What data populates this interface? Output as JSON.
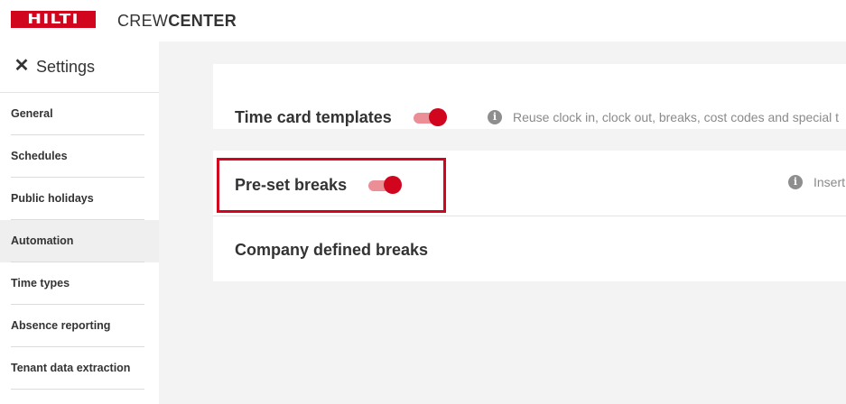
{
  "header": {
    "logo_text": "HILTI",
    "product_name_part1": "CREW",
    "product_name_part2": "CENTER",
    "brand_color": "#d2051e"
  },
  "sidebar": {
    "title": "Settings",
    "close_icon": "close-icon",
    "items": [
      {
        "label": "General",
        "active": false
      },
      {
        "label": "Schedules",
        "active": false
      },
      {
        "label": "Public holidays",
        "active": false
      },
      {
        "label": "Automation",
        "active": true
      },
      {
        "label": "Time types",
        "active": false
      },
      {
        "label": "Absence reporting",
        "active": false
      },
      {
        "label": "Tenant data extraction",
        "active": false
      }
    ]
  },
  "main": {
    "time_card_templates": {
      "title": "Time card templates",
      "toggle_on": true,
      "description": "Reuse clock in, clock out, breaks, cost codes and special t"
    },
    "preset_breaks": {
      "title": "Pre-set breaks",
      "toggle_on": true,
      "description": "Insert",
      "highlighted": true
    },
    "company_defined_breaks": {
      "title": "Company defined breaks"
    }
  },
  "colors": {
    "accent": "#d2051e",
    "toggle_track": "#eb8e96",
    "main_bg": "#f3f3f3",
    "active_nav_bg": "#efefef"
  }
}
